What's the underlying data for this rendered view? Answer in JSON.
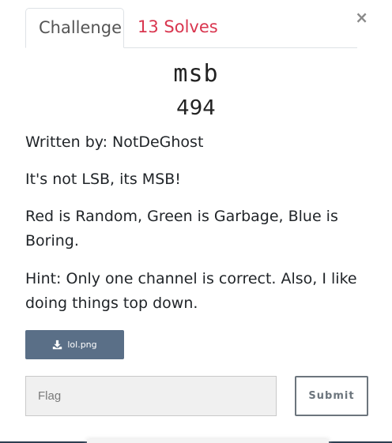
{
  "modal": {
    "close_label": "×"
  },
  "tabs": {
    "challenge_label": "Challenge",
    "solves_label": "13 Solves"
  },
  "challenge": {
    "name": "msb",
    "points": "494",
    "description": [
      "Written by: NotDeGhost",
      "It's not LSB, its MSB!",
      "Red is Random, Green is Garbage, Blue is Boring.",
      "Hint: Only one channel is correct. Also, I like doing things top down."
    ],
    "file_label": "lol.png"
  },
  "form": {
    "flag_placeholder": "Flag",
    "submit_label": "Submit"
  },
  "colors": {
    "solves_accent": "#d9364f",
    "file_button_bg": "#5a6f87",
    "submit_border": "#6c757d"
  },
  "icons": {
    "close": "close-icon",
    "file": "download-icon"
  }
}
